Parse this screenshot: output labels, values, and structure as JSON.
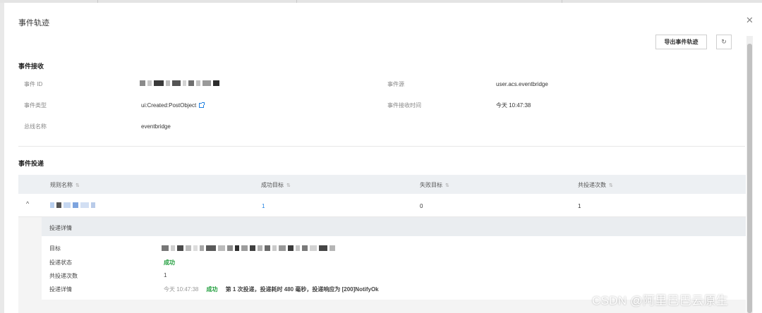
{
  "dialog": {
    "title": "事件轨迹",
    "export_label": "导出事件轨迹",
    "refresh_glyph": "↻",
    "close_glyph": "✕"
  },
  "receive": {
    "title": "事件接收",
    "event_id_label": "事件 ID",
    "event_source_label": "事件源",
    "event_source_value": "user.acs.eventbridge",
    "event_type_label": "事件类型",
    "event_type_value": "ui:Created:PostObject",
    "receive_time_label": "事件接收时间",
    "receive_time_value": "今天 10:47:38",
    "bus_name_label": "总线名称",
    "bus_name_value": "eventbridge"
  },
  "delivery": {
    "title": "事件投递",
    "columns": [
      "规则名称",
      "成功目标",
      "失败目标",
      "共投递次数"
    ],
    "sort_glyph": "⇅",
    "row": {
      "expand_glyph": "^",
      "success": "1",
      "failed": "0",
      "total": "1"
    },
    "detail": {
      "header": "投递详情",
      "target_label": "目标",
      "status_label": "投递状态",
      "status_value": "成功",
      "count_label": "共投递次数",
      "count_value": "1",
      "detail_label": "投递详情",
      "detail_time": "今天 10:47:38",
      "detail_status": "成功",
      "detail_prefix": "第",
      "detail_nth": "1",
      "detail_mid": "次投递，投递耗时",
      "detail_ms": "480",
      "detail_suffix": "毫秒，投递响应为",
      "detail_response": "[200]NotifyOk"
    }
  },
  "watermark": "CSDN @阿里巴巴云原生",
  "colors": {
    "link": "#1d7fe0",
    "success": "#1e9d3b",
    "header_bg": "#edf0f3"
  }
}
